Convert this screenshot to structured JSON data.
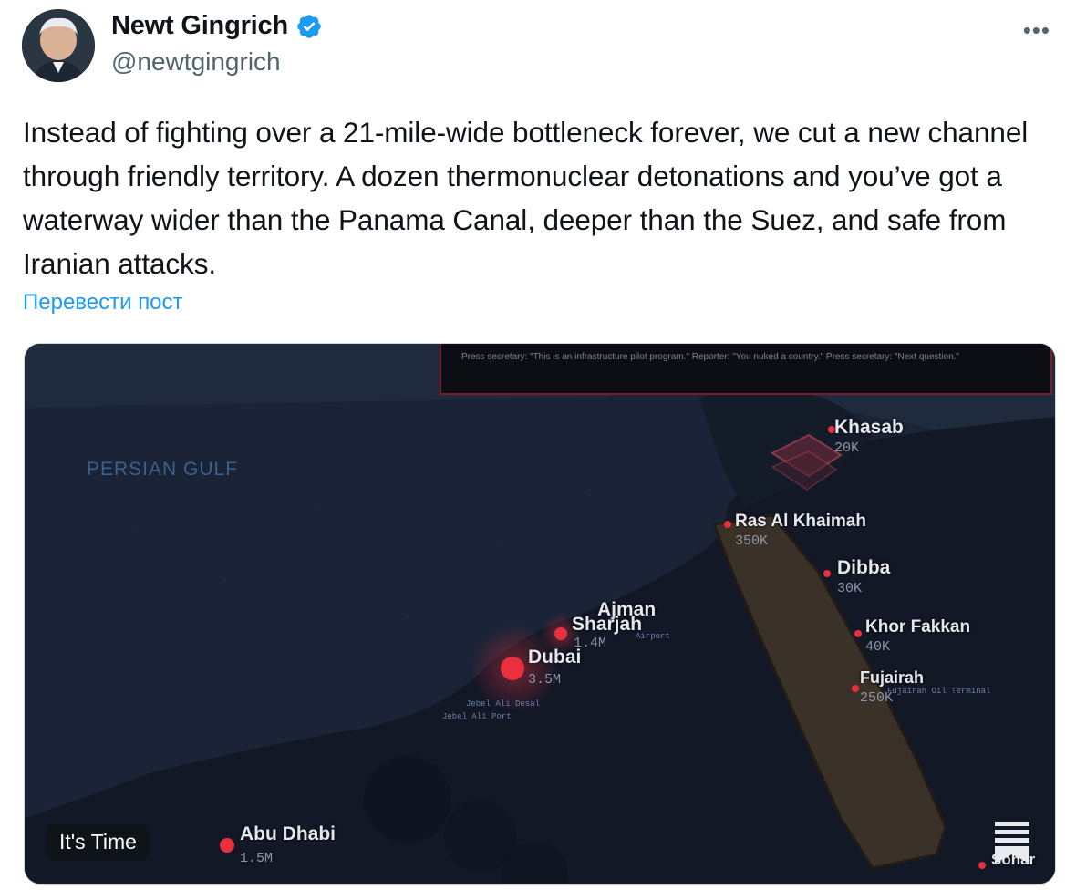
{
  "author": {
    "name": "Newt Gingrich",
    "handle": "@newtgingrich",
    "verified": true,
    "avatar_icon": "profile-photo"
  },
  "menu": {
    "more_label": "•••"
  },
  "tweet": {
    "text": "Instead of fighting over a 21-mile-wide bottleneck forever, we cut a new channel through friendly territory. A dozen thermonuclear detonations and you’ve got a waterway wider than the Panama Canal, deeper than the Suez, and safe from Iranian attacks.",
    "translate_label": "Перевести пост"
  },
  "media": {
    "banner_text": "Press secretary: \"This is an infrastructure pilot program.\" Reporter: \"You nuked a country.\" Press secretary: \"Next question.\"",
    "region_label": "PERSIAN GULF",
    "video_badge": "It's Time",
    "cities": [
      {
        "name": "Khasab",
        "population": "20K"
      },
      {
        "name": "Ras Al Khaimah",
        "population": "350K"
      },
      {
        "name": "Dibba",
        "population": "30K"
      },
      {
        "name": "Khor Fakkan",
        "population": "40K"
      },
      {
        "name": "Ajman",
        "population": ""
      },
      {
        "name": "Sharjah",
        "population": "1.4M"
      },
      {
        "name": "Dubai",
        "population": "3.5M"
      },
      {
        "name": "Fujairah",
        "population": "250K"
      },
      {
        "name": "Abu Dhabi",
        "population": "1.5M"
      },
      {
        "name": "Sohar",
        "population": ""
      }
    ],
    "ports": [
      "Jebel Ali Port",
      "Fujairah Oil Terminal",
      "Jebel Ali Desal",
      "Airport"
    ],
    "accent_red": "#e8303f",
    "channel_color": "#3a3229"
  }
}
